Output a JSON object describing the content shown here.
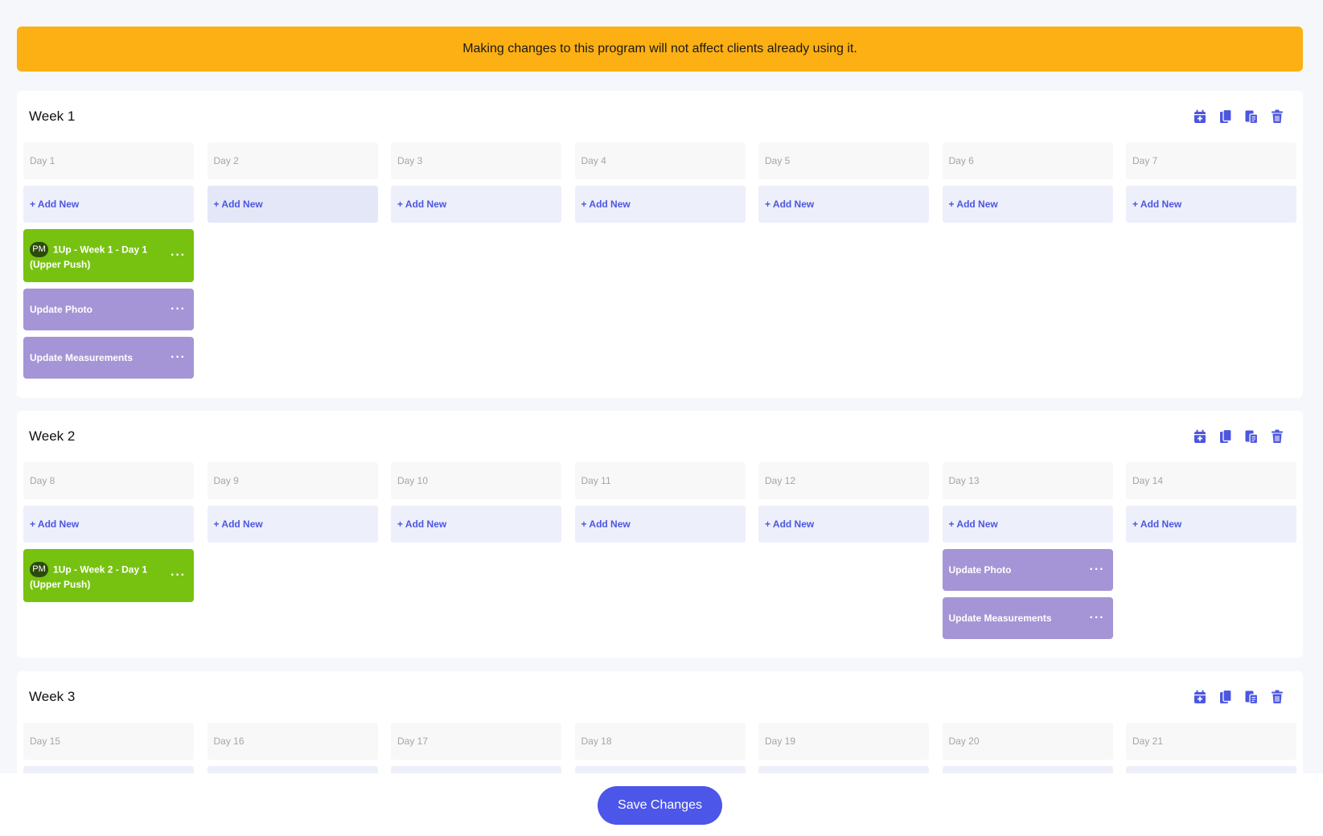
{
  "banner": {
    "message": "Making changes to this program will not affect clients already using it."
  },
  "add_label": "+ Add New",
  "colors": {
    "accent": "#4c56e9",
    "banner": "#fdb013",
    "workout": "#77c211",
    "task": "#a595d6"
  },
  "weeks": [
    {
      "title": "Week 1",
      "days": [
        {
          "label": "Day 1",
          "cards": [
            {
              "kind": "workout",
              "badge": "PM",
              "title": "1Up - Week 1 - Day 1 (Upper Push)"
            },
            {
              "kind": "task",
              "title": "Update Photo"
            },
            {
              "kind": "task",
              "title": "Update Measurements"
            }
          ]
        },
        {
          "label": "Day 2",
          "cards": []
        },
        {
          "label": "Day 3",
          "cards": []
        },
        {
          "label": "Day 4",
          "cards": []
        },
        {
          "label": "Day 5",
          "cards": []
        },
        {
          "label": "Day 6",
          "cards": []
        },
        {
          "label": "Day 7",
          "cards": []
        }
      ]
    },
    {
      "title": "Week 2",
      "days": [
        {
          "label": "Day 8",
          "cards": [
            {
              "kind": "workout",
              "badge": "PM",
              "title": "1Up - Week 2 - Day 1 (Upper Push)"
            }
          ]
        },
        {
          "label": "Day 9",
          "cards": []
        },
        {
          "label": "Day 10",
          "cards": []
        },
        {
          "label": "Day 11",
          "cards": []
        },
        {
          "label": "Day 12",
          "cards": []
        },
        {
          "label": "Day 13",
          "cards": [
            {
              "kind": "task",
              "title": "Update Photo"
            },
            {
              "kind": "task",
              "title": "Update Measurements"
            }
          ]
        },
        {
          "label": "Day 14",
          "cards": []
        }
      ]
    },
    {
      "title": "Week 3",
      "days": [
        {
          "label": "Day 15",
          "cards": []
        },
        {
          "label": "Day 16",
          "cards": []
        },
        {
          "label": "Day 17",
          "cards": []
        },
        {
          "label": "Day 18",
          "cards": []
        },
        {
          "label": "Day 19",
          "cards": []
        },
        {
          "label": "Day 20",
          "cards": []
        },
        {
          "label": "Day 21",
          "cards": []
        }
      ]
    }
  ],
  "footer": {
    "save_label": "Save Changes"
  }
}
